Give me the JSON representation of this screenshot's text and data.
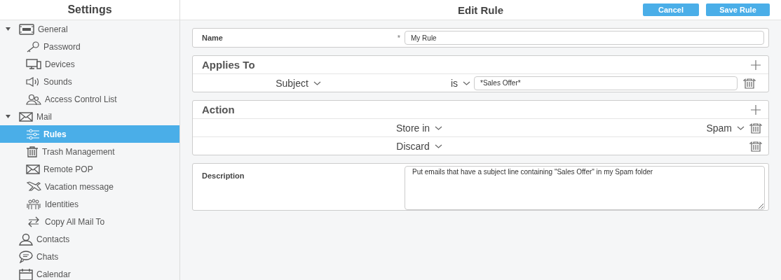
{
  "sidebar": {
    "title": "Settings",
    "items": [
      {
        "label": "General",
        "expanded": true,
        "selected": false,
        "children": [
          {
            "label": "Password",
            "selected": false
          },
          {
            "label": "Devices",
            "selected": false
          },
          {
            "label": "Sounds",
            "selected": false
          },
          {
            "label": "Access Control List",
            "selected": false
          }
        ]
      },
      {
        "label": "Mail",
        "expanded": true,
        "selected": false,
        "children": [
          {
            "label": "Rules",
            "selected": true
          },
          {
            "label": "Trash Management",
            "selected": false
          },
          {
            "label": "Remote POP",
            "selected": false
          },
          {
            "label": "Vacation message",
            "selected": false
          },
          {
            "label": "Identities",
            "selected": false
          },
          {
            "label": "Copy All Mail To",
            "selected": false
          }
        ]
      },
      {
        "label": "Contacts",
        "selected": false
      },
      {
        "label": "Chats",
        "selected": false
      },
      {
        "label": "Calendar",
        "selected": false
      }
    ]
  },
  "header": {
    "title": "Edit Rule",
    "buttons": [
      "Cancel",
      "Save Rule"
    ]
  },
  "name_field": {
    "label": "Name",
    "required_mark": "*",
    "value": "My Rule"
  },
  "applies_to": {
    "title": "Applies To",
    "conditions": [
      {
        "field": "Subject",
        "operator": "is",
        "value": "*Sales Offer*"
      }
    ]
  },
  "action": {
    "title": "Action",
    "actions": [
      {
        "action": "Store in",
        "target": "Spam"
      },
      {
        "action": "Discard"
      }
    ]
  },
  "description": {
    "label": "Description",
    "value": "Put emails that have a subject line containing \"Sales Offer\" in my Spam folder"
  }
}
